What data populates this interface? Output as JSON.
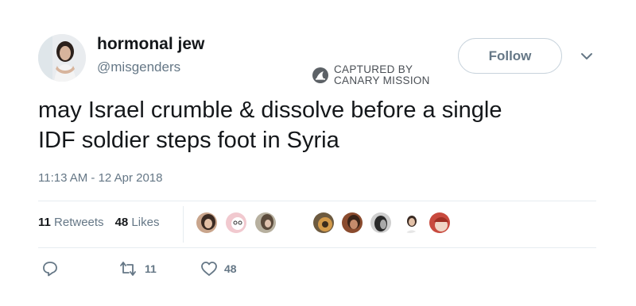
{
  "user": {
    "name": "hormonal jew",
    "handle": "@misgenders"
  },
  "follow_label": "Follow",
  "watermark": {
    "line1": "CAPTURED BY",
    "line2": "CANARY MISSION"
  },
  "tweet": {
    "line1": "may Israel crumble & dissolve before a single",
    "line2": "IDF soldier steps foot in Syria",
    "timestamp": "11:13 AM - 12 Apr 2018"
  },
  "stats": {
    "retweets_count": "11",
    "retweets_label": "Retweets",
    "likes_count": "48",
    "likes_label": "Likes"
  },
  "actions": {
    "retweet_count": "11",
    "like_count": "48"
  },
  "colors": {
    "text": "#14171a",
    "secondary": "#657786",
    "divider": "#e6ecf0",
    "button_border": "#c8d3dc"
  }
}
